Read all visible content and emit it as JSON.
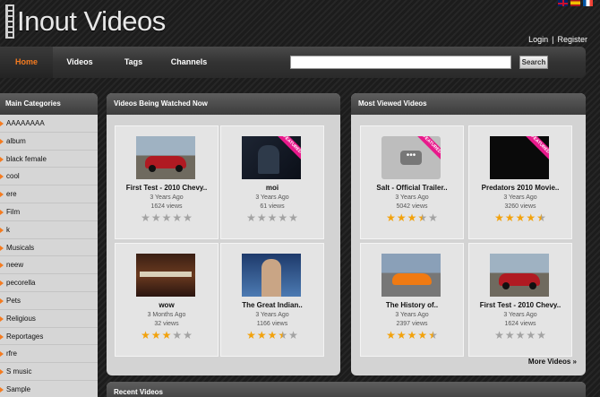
{
  "header": {
    "logo_text": "Inout Videos",
    "login": "Login",
    "separator": "|",
    "register": "Register"
  },
  "nav": {
    "items": [
      "Home",
      "Videos",
      "Tags",
      "Channels"
    ],
    "active": "Home",
    "search_value": "",
    "search_button": "Search"
  },
  "colors": {
    "accent": "#f47b20",
    "featured": "#e8198b",
    "star": "#f2a20d"
  },
  "sidebar": {
    "title": "Main Categories",
    "items": [
      "AAAAAAAA",
      "album",
      "black female",
      "cool",
      "ere",
      "Film",
      "k",
      "Musicals",
      "neew",
      "pecorella",
      "Pets",
      "Religious",
      "Reportages",
      "rfre",
      "S music",
      "Sample"
    ]
  },
  "watched": {
    "title": "Videos Being Watched Now",
    "videos": [
      {
        "title": "First Test - 2010 Chevy..",
        "age": "3 Years Ago",
        "views": "1624 views",
        "rating": 0,
        "featured": false,
        "thumb": "red-car"
      },
      {
        "title": "moi",
        "age": "3 Years Ago",
        "views": "61 views",
        "rating": 0,
        "featured": true,
        "featured_label": "FEATURED",
        "thumb": "dark-scene"
      },
      {
        "title": "wow",
        "age": "3 Months Ago",
        "views": "32 views",
        "rating": 3,
        "featured": false,
        "thumb": "movie-scene"
      },
      {
        "title": "The Great Indian..",
        "age": "3 Years Ago",
        "views": "1166 views",
        "rating": 3.5,
        "featured": false,
        "thumb": "news-anchor"
      }
    ]
  },
  "viewed": {
    "title": "Most Viewed Videos",
    "more_link": "More Videos »",
    "videos": [
      {
        "title": "Salt - Official Trailer..",
        "age": "3 Years Ago",
        "views": "5042 views",
        "rating": 3.5,
        "featured": true,
        "featured_label": "FEATURED",
        "thumb": "placeholder"
      },
      {
        "title": "Predators 2010 Movie..",
        "age": "3 Years Ago",
        "views": "3260 views",
        "rating": 4.5,
        "featured": true,
        "featured_label": "FEATURED",
        "thumb": "predators"
      },
      {
        "title": "The History of..",
        "age": "3 Years Ago",
        "views": "2397 views",
        "rating": 4.5,
        "featured": false,
        "thumb": "orange-car"
      },
      {
        "title": "First Test - 2010 Chevy..",
        "age": "3 Years Ago",
        "views": "1624 views",
        "rating": 0,
        "featured": false,
        "thumb": "red-car"
      }
    ]
  },
  "recent": {
    "title": "Recent Videos"
  }
}
